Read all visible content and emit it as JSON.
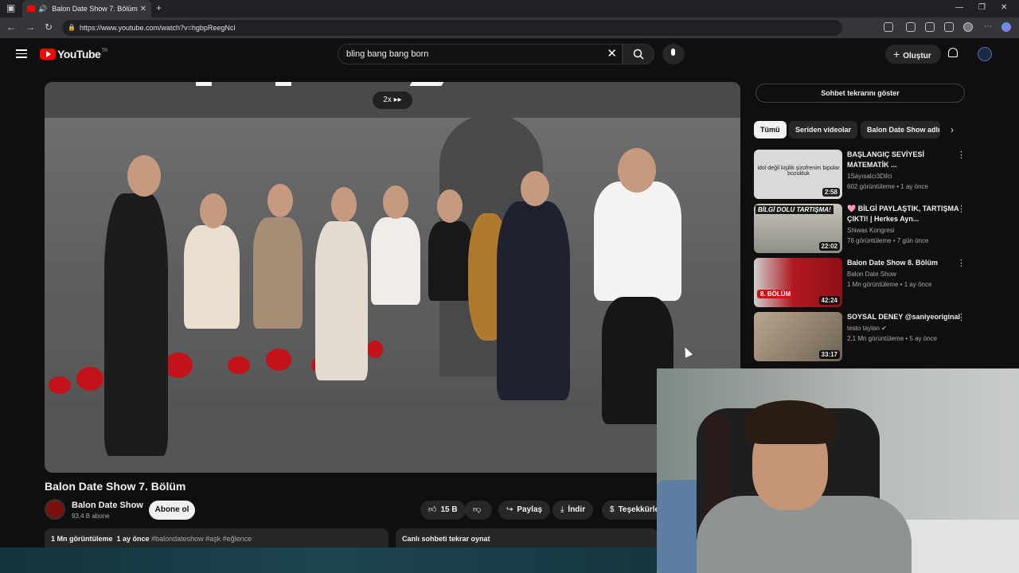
{
  "browser": {
    "tab_title": "Balon Date Show 7. Bölüm",
    "url": "https://www.youtube.com/watch?v=hgbpReegNcl"
  },
  "youtube": {
    "logo_text": "YouTube",
    "logo_country": "TR",
    "search_value": "bling bang bang born",
    "create_label": "Oluştur"
  },
  "video": {
    "speed": "2x",
    "title": "Balon Date Show 7. Bölüm",
    "channel": "Balon Date Show",
    "subscribers": "93,4 B abone",
    "subscribe_label": "Abone ol",
    "likes": "15 B",
    "share_label": "Paylaş",
    "download_label": "İndir",
    "thanks_label": "Teşekkürler",
    "views": "1 Mn görüntüleme",
    "age": "1 ay önce",
    "hashtags": "#balondateshow #aşk #eğlence",
    "chat_replay_label": "Canlı sohbeti tekrar oynat"
  },
  "sidebar": {
    "live_chat_label": "Sohbet tekrarını göster",
    "chips": [
      "Tümü",
      "Seriden videolar",
      "Balon Date Show adlı"
    ],
    "recommendations": [
      {
        "title": "BAŞLANGIÇ SEVİYESİ MATEMATİK ...",
        "channel": "1Sayısalcı3Dilci",
        "meta": "602 görüntüleme • 1 ay önce",
        "duration": "2:58",
        "thumb_text": "idol değil kişilik şizofrenim bipolar bozukluk",
        "thumb_color": "#d9d9d9"
      },
      {
        "title": "🩷 BİLGİ PAYLAŞTIK, TARTIŞMA ÇIKTI! | Herkes Ayn...",
        "channel": "Shiwas Kongresi",
        "meta": "76 görüntüleme • 7 gün önce",
        "duration": "22:02",
        "thumb_text": "BİLGİ DOLU TARTIŞMA!",
        "thumb_color": "#c9c4bc"
      },
      {
        "title": "Balon Date Show 8. Bölüm",
        "channel": "Balon Date Show",
        "meta": "1 Mn görüntüleme • 1 ay önce",
        "duration": "42:24",
        "thumb_text": "8. BÖLÜM",
        "thumb_color": "#a01018"
      },
      {
        "title": "SOYSAL DENEY @saniyeoriginal",
        "channel": "testo taylan",
        "meta": "2,1 Mn görüntüleme • 5 ay önce",
        "duration": "33:17",
        "thumb_text": "",
        "thumb_color": "#8a7d6c"
      }
    ]
  },
  "colors": {
    "youtube_red": "#ff0000",
    "bg": "#0f0f0f"
  }
}
